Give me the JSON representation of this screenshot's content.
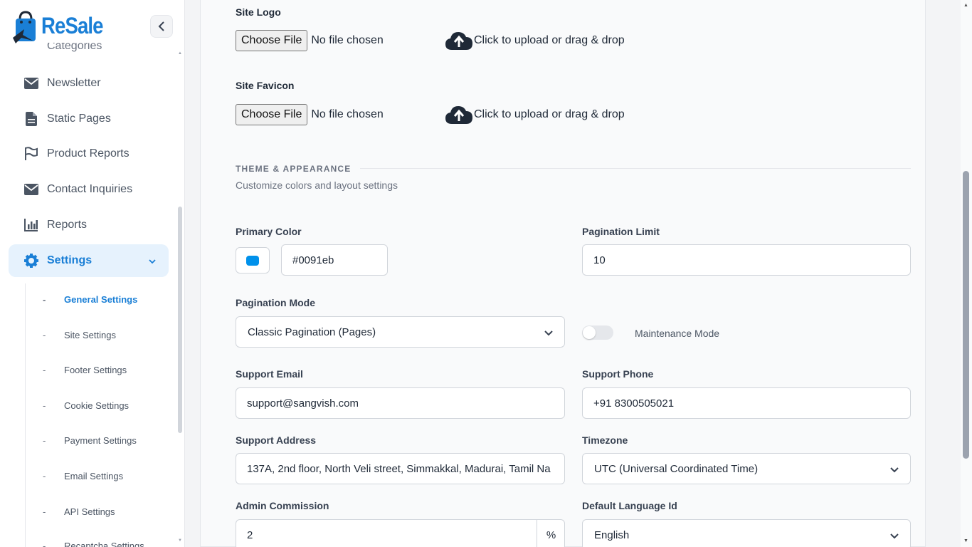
{
  "brand": {
    "name": "ReSale",
    "color": "#1a7fd6"
  },
  "sidebar": {
    "cut_item": "Categories",
    "items": [
      {
        "label": "Newsletter",
        "icon": "envelope-icon"
      },
      {
        "label": "Static Pages",
        "icon": "file-icon"
      },
      {
        "label": "Product Reports",
        "icon": "flag-icon"
      },
      {
        "label": "Contact Inquiries",
        "icon": "envelope-icon"
      },
      {
        "label": "Reports",
        "icon": "chart-icon"
      },
      {
        "label": "Settings",
        "icon": "gear-icon",
        "active": true
      }
    ],
    "sub_items": [
      {
        "label": "General Settings",
        "active": true
      },
      {
        "label": "Site Settings"
      },
      {
        "label": "Footer Settings"
      },
      {
        "label": "Cookie Settings"
      },
      {
        "label": "Payment Settings"
      },
      {
        "label": "Email Settings"
      },
      {
        "label": "API Settings"
      },
      {
        "label": "Recaptcha Settings"
      }
    ],
    "dash": "-"
  },
  "main": {
    "site_logo": {
      "label": "Site Logo",
      "button": "Choose File",
      "status": "No file chosen",
      "upload_text": "Click to upload or drag & drop"
    },
    "site_favicon": {
      "label": "Site Favicon",
      "button": "Choose File",
      "status": "No file chosen",
      "upload_text": "Click to upload or drag & drop"
    },
    "theme": {
      "title": "THEME & APPEARANCE",
      "subtitle": "Customize colors and layout settings"
    },
    "primary_color": {
      "label": "Primary Color",
      "value": "#0091eb",
      "swatch": "#0091eb"
    },
    "pagination_limit": {
      "label": "Pagination Limit",
      "value": "10"
    },
    "pagination_mode": {
      "label": "Pagination Mode",
      "value": "Classic Pagination (Pages)"
    },
    "maintenance": {
      "label": "Maintenance Mode",
      "enabled": false
    },
    "support_email": {
      "label": "Support Email",
      "value": "support@sangvish.com"
    },
    "support_phone": {
      "label": "Support Phone",
      "value": "+91 8300505021"
    },
    "support_address": {
      "label": "Support Address",
      "value": "137A, 2nd floor, North Veli street, Simmakkal,  Madurai, Tamil Na"
    },
    "timezone": {
      "label": "Timezone",
      "value": "UTC (Universal Coordinated Time)"
    },
    "admin_commission": {
      "label": "Admin Commission",
      "value": "2",
      "suffix": "%"
    },
    "default_language": {
      "label": "Default Language Id",
      "value": "English"
    }
  }
}
